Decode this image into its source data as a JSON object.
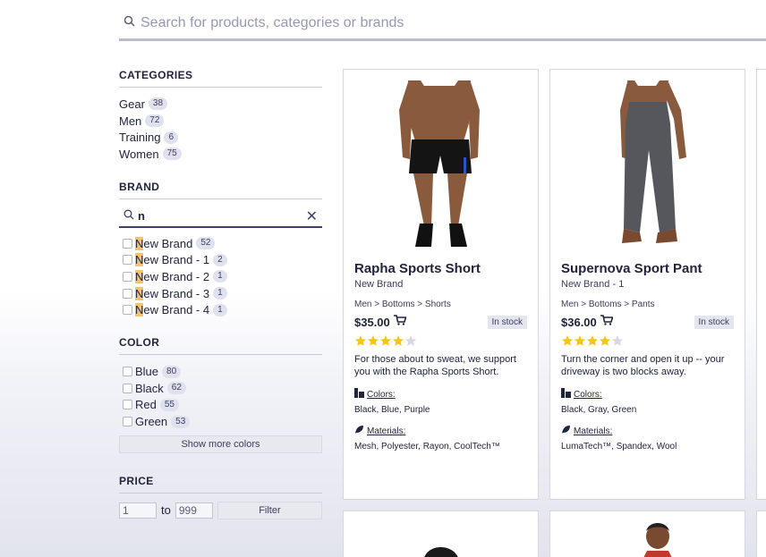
{
  "search": {
    "placeholder": "Search for products, categories or brands"
  },
  "categories": {
    "title": "CATEGORIES",
    "items": [
      {
        "label": "Gear",
        "count": "38"
      },
      {
        "label": "Men",
        "count": "72"
      },
      {
        "label": "Training",
        "count": "6"
      },
      {
        "label": "Women",
        "count": "75"
      }
    ]
  },
  "brand": {
    "title": "BRAND",
    "search_value": "n",
    "highlight": "N",
    "items": [
      {
        "rest": "ew Brand",
        "count": "52"
      },
      {
        "rest": "ew Brand - 1",
        "count": "2"
      },
      {
        "rest": "ew Brand - 2",
        "count": "1"
      },
      {
        "rest": "ew Brand - 3",
        "count": "1"
      },
      {
        "rest": "ew Brand - 4",
        "count": "1"
      }
    ]
  },
  "color": {
    "title": "COLOR",
    "items": [
      {
        "label": "Blue",
        "count": "80"
      },
      {
        "label": "Black",
        "count": "62"
      },
      {
        "label": "Red",
        "count": "55"
      },
      {
        "label": "Green",
        "count": "53"
      }
    ],
    "show_more": "Show more colors"
  },
  "price": {
    "title": "PRICE",
    "min": "1",
    "to": "to",
    "max": "999",
    "filter": "Filter"
  },
  "products": [
    {
      "name": "Rapha Sports Short",
      "brand": "New Brand",
      "category": "Men > Bottoms > Shorts",
      "price": "$35.00",
      "stock": "In stock",
      "rating": 4,
      "description": "For those about to sweat, we support you with the Rapha Sports Short.",
      "colors_label": "Colors:",
      "colors": "Black, Blue, Purple",
      "materials_label": "Materials:",
      "materials": "Mesh, Polyester, Rayon, CoolTech™"
    },
    {
      "name": "Supernova Sport Pant",
      "brand": "New Brand - 1",
      "category": "Men > Bottoms > Pants",
      "price": "$36.00",
      "stock": "In stock",
      "rating": 4,
      "description": "Turn the corner and open it up -- your driveway is two blocks away.",
      "colors_label": "Colors:",
      "colors": "Black, Gray, Green",
      "materials_label": "Materials:",
      "materials": "LumaTech™, Spandex, Wool"
    }
  ],
  "colors": {
    "star": "#f5c518",
    "star_empty": "#d6d8e1",
    "accent": "#21243d",
    "highlight": "#f8c36a"
  }
}
